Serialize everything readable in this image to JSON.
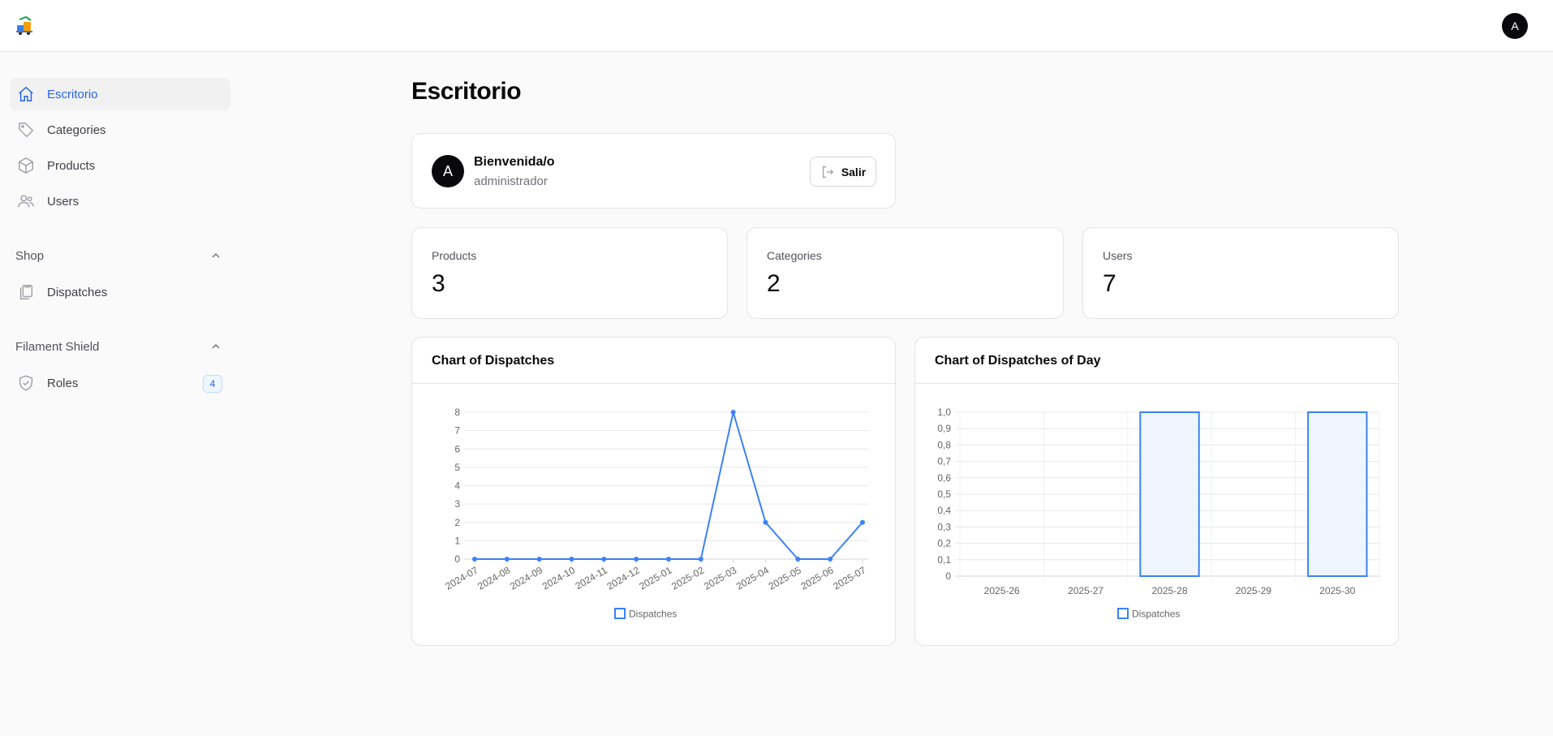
{
  "header": {
    "user_initial": "A"
  },
  "sidebar": {
    "items": [
      {
        "label": "Escritorio",
        "icon": "home-icon",
        "active": true
      },
      {
        "label": "Categories",
        "icon": "tag-icon"
      },
      {
        "label": "Products",
        "icon": "cube-icon"
      },
      {
        "label": "Users",
        "icon": "users-icon"
      }
    ],
    "groups": [
      {
        "label": "Shop",
        "items": [
          {
            "label": "Dispatches",
            "icon": "clipboard-icon"
          }
        ]
      },
      {
        "label": "Filament Shield",
        "items": [
          {
            "label": "Roles",
            "icon": "shield-check-icon",
            "badge": "4"
          }
        ]
      }
    ]
  },
  "main": {
    "title": "Escritorio",
    "welcome": {
      "initial": "A",
      "title": "Bienvenida/o",
      "subtitle": "administrador",
      "logout_label": "Salir"
    },
    "stats": [
      {
        "label": "Products",
        "value": "3"
      },
      {
        "label": "Categories",
        "value": "2"
      },
      {
        "label": "Users",
        "value": "7"
      }
    ]
  },
  "colors": {
    "accent": "#2563eb",
    "series": "#3b82f6",
    "bar_fill": "#eff6ff"
  },
  "chart_data": [
    {
      "type": "line",
      "title": "Chart of Dispatches",
      "x": [
        "2024-07",
        "2024-08",
        "2024-09",
        "2024-10",
        "2024-11",
        "2024-12",
        "2025-01",
        "2025-02",
        "2025-03",
        "2025-04",
        "2025-05",
        "2025-06",
        "2025-07"
      ],
      "series": [
        {
          "name": "Dispatches",
          "values": [
            0,
            0,
            0,
            0,
            0,
            0,
            0,
            0,
            8,
            2,
            0,
            0,
            2
          ]
        }
      ],
      "yticks": [
        "0",
        "1",
        "2",
        "3",
        "4",
        "5",
        "6",
        "7",
        "8"
      ],
      "ylim": [
        0,
        8
      ],
      "grid": true,
      "legend": "bottom"
    },
    {
      "type": "bar",
      "title": "Chart of Dispatches of Day",
      "categories": [
        "2025-26",
        "2025-27",
        "2025-28",
        "2025-29",
        "2025-30"
      ],
      "series": [
        {
          "name": "Dispatches",
          "values": [
            0,
            0,
            1,
            0,
            1
          ]
        }
      ],
      "yticks": [
        "0",
        "0,1",
        "0,2",
        "0,3",
        "0,4",
        "0,5",
        "0,6",
        "0,7",
        "0,8",
        "0,9",
        "1,0"
      ],
      "ylim": [
        0,
        1
      ],
      "grid": true,
      "legend": "bottom"
    }
  ]
}
